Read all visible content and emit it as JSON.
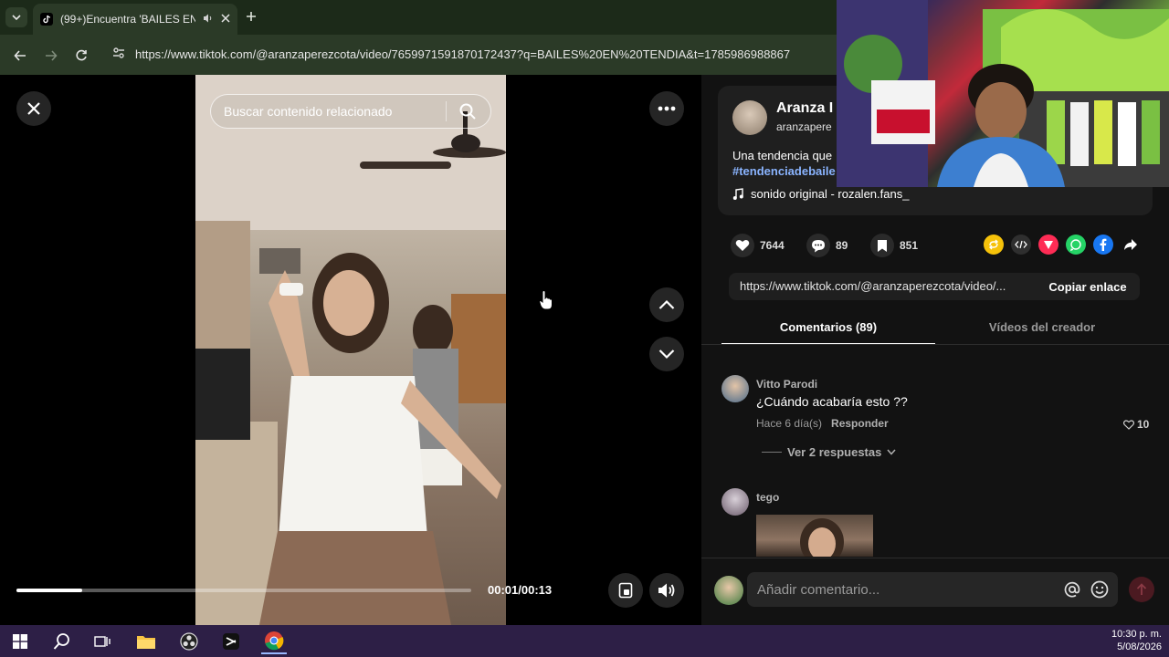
{
  "browser": {
    "tab_title": "(99+)Encuentra 'BAILES EN",
    "url": "https://www.tiktok.com/@aranzaperezcota/video/7659971591870172437?q=BAILES%20EN%20TENDIA&t=1785986988867"
  },
  "player": {
    "search_placeholder": "Buscar contenido relacionado",
    "time": "00:01/00:13",
    "progress_fraction": 0.145
  },
  "author": {
    "name": "Aranza I",
    "handle": "aranzapere",
    "description": "Una tendencia que",
    "hashtag": "#tendenciadebaile",
    "music": "sonido original - rozalen.fans_"
  },
  "stats": {
    "likes": "7644",
    "comments": "89",
    "saves": "851"
  },
  "share": {
    "link": "https://www.tiktok.com/@aranzaperezcota/video/...",
    "copy_label": "Copiar enlace"
  },
  "tabs": {
    "comments": "Comentarios (89)",
    "creator_videos": "Vídeos del creador"
  },
  "comments": [
    {
      "user": "Vitto Parodi",
      "text": "¿Cuándo acabaría esto ??",
      "time": "Hace 6 día(s)",
      "reply_label": "Responder",
      "likes": "10",
      "more_replies": "Ver 2 respuestas"
    },
    {
      "user": "tego"
    }
  ],
  "composer": {
    "placeholder": "Añadir comentario..."
  },
  "taskbar": {
    "time": "10:30 p. m.",
    "date": "5/08/2026"
  },
  "colors": {
    "accent_red": "#fe2c55",
    "panel_bg": "#121212",
    "browser_bg": "#2b3a27",
    "taskbar_bg": "#2d1f46"
  }
}
